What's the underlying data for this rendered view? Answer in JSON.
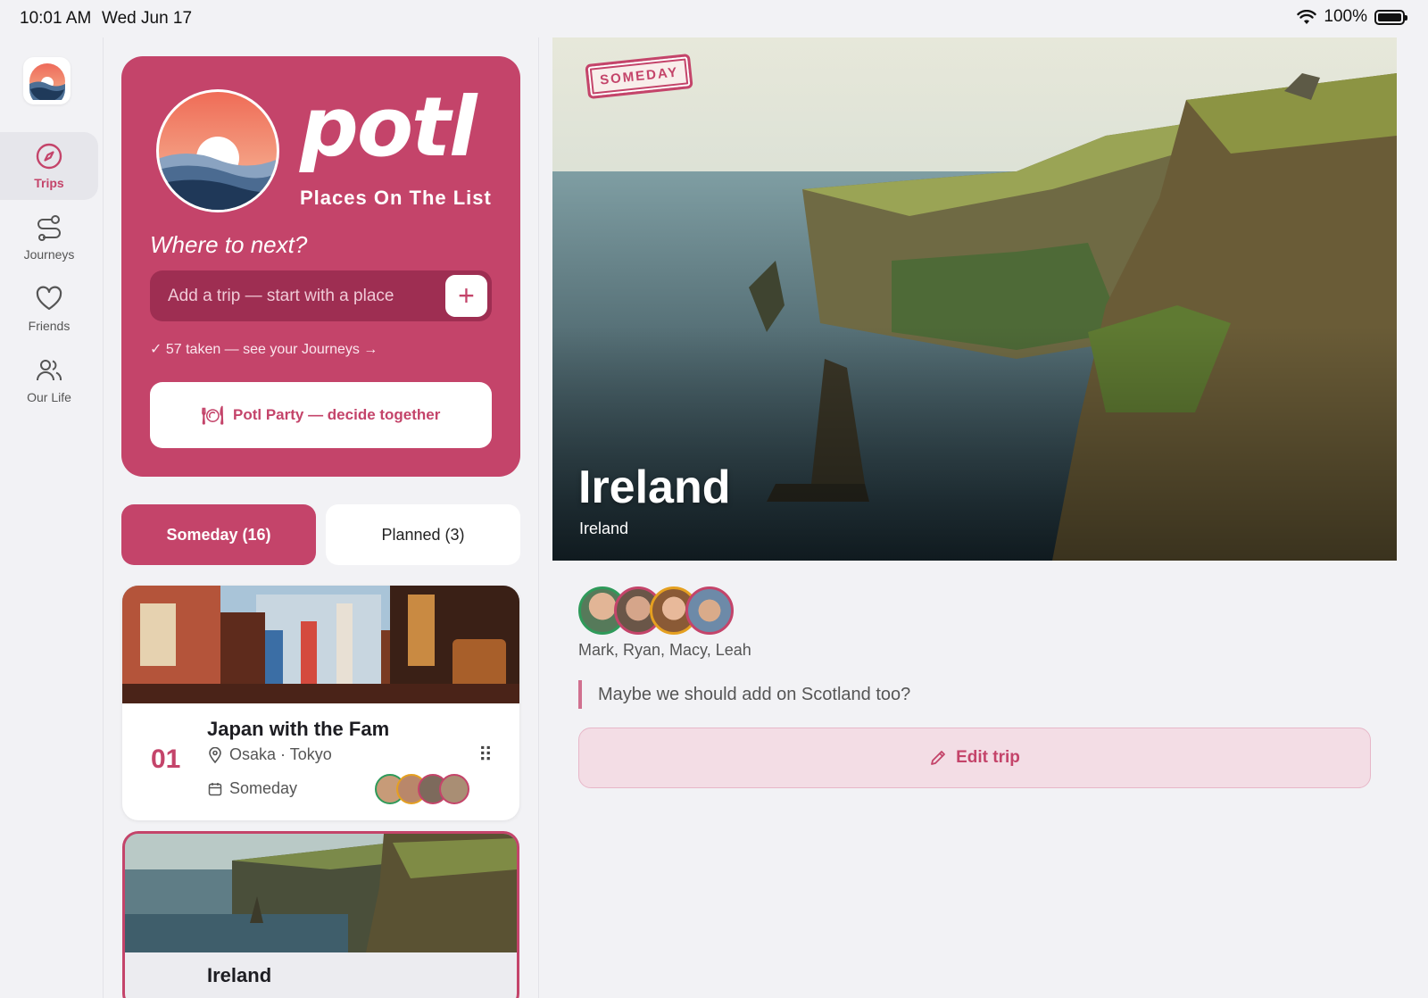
{
  "status_bar": {
    "time": "10:01 AM",
    "date": "Wed Jun 17",
    "battery": "100%"
  },
  "sidebar": {
    "items": [
      {
        "label": "Trips",
        "icon": "compass-icon"
      },
      {
        "label": "Journeys",
        "icon": "route-icon"
      },
      {
        "label": "Friends",
        "icon": "heart-icon"
      },
      {
        "label": "Our Life",
        "icon": "people-icon"
      }
    ]
  },
  "hero": {
    "brand": "potl",
    "tagline": "Places On The List",
    "prompt": "Where to next?",
    "add_placeholder": "Add a trip — start with a place",
    "taken_link": "✓ 57 taken — see your Journeys →",
    "party_button": "Potl Party — decide together"
  },
  "tabs": {
    "someday": "Someday (16)",
    "planned": "Planned (3)"
  },
  "trips": [
    {
      "number": "01",
      "title": "Japan with the Fam",
      "places": "Osaka · Tokyo",
      "when": "Someday"
    },
    {
      "title": "Ireland"
    }
  ],
  "detail": {
    "stamp": "SOMEDAY",
    "title": "Ireland",
    "subtitle": "Ireland",
    "travelers": "Mark, Ryan, Macy, Leah",
    "note": "Maybe we should add on Scotland too?",
    "edit_button": "Edit trip"
  },
  "colors": {
    "accent": "#c4446a",
    "accent_dark": "#9e2e52",
    "background": "#f2f2f5"
  }
}
